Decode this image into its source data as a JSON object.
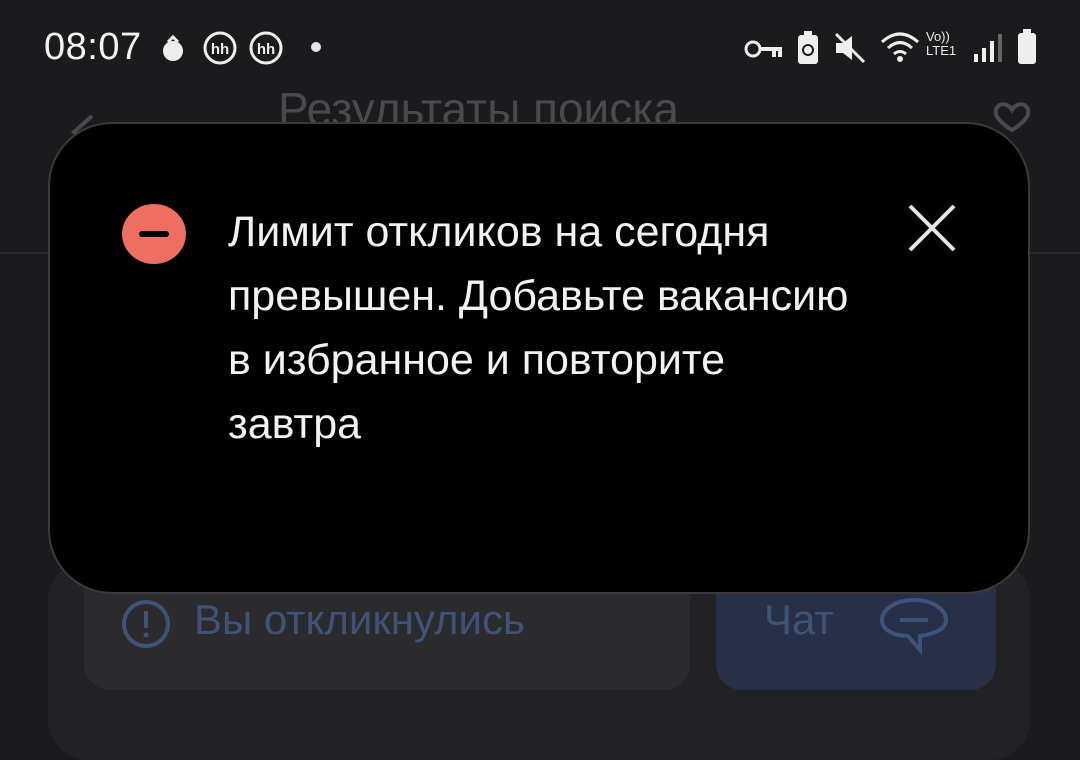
{
  "status_bar": {
    "time": "08:07",
    "network_label": "Vo)) LTE1"
  },
  "screen": {
    "title": "Результаты поиска",
    "responded_label": "Вы откликнулись",
    "chat_label": "Чат"
  },
  "toast": {
    "message": "Лимит откликов на сегодня превышен. Добавьте вакансию в избранное и повторите завтра",
    "error_color": "#ef6e62"
  },
  "colors": {
    "background": "#1b1b1d",
    "toast_background": "#000000",
    "accent_dimmed": "#3f5378"
  }
}
